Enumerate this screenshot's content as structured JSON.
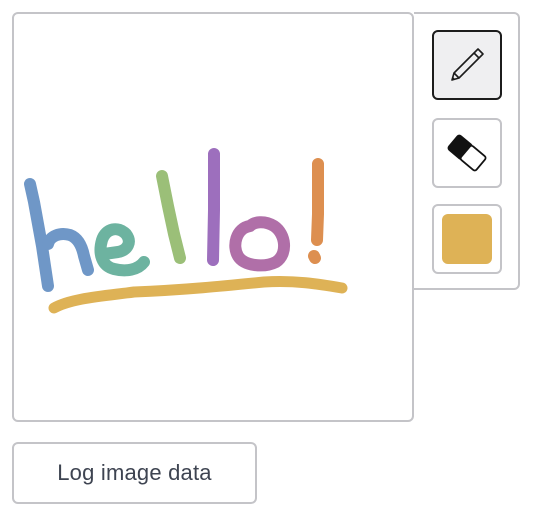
{
  "canvas": {
    "strokes": [
      {
        "name": "stroke-h-stem",
        "color": "#6f97c7"
      },
      {
        "name": "stroke-h-arch",
        "color": "#6f97c7"
      },
      {
        "name": "stroke-e",
        "color": "#6db3a0"
      },
      {
        "name": "stroke-l1",
        "color": "#9bbf78"
      },
      {
        "name": "stroke-l2",
        "color": "#9d6fbd"
      },
      {
        "name": "stroke-o",
        "color": "#b06fa8"
      },
      {
        "name": "stroke-exclaim-bar",
        "color": "#dd8f50"
      },
      {
        "name": "stroke-exclaim-dot",
        "color": "#dd8f50"
      },
      {
        "name": "stroke-underline",
        "color": "#deb256"
      }
    ]
  },
  "toolbar": {
    "tools": [
      {
        "id": "pencil",
        "icon": "pencil-icon",
        "active": true
      },
      {
        "id": "eraser",
        "icon": "eraser-icon",
        "active": false
      },
      {
        "id": "color",
        "icon": "color-swatch",
        "active": false
      }
    ],
    "selected_color": "#deb256"
  },
  "log_button": {
    "label": "Log image data"
  }
}
